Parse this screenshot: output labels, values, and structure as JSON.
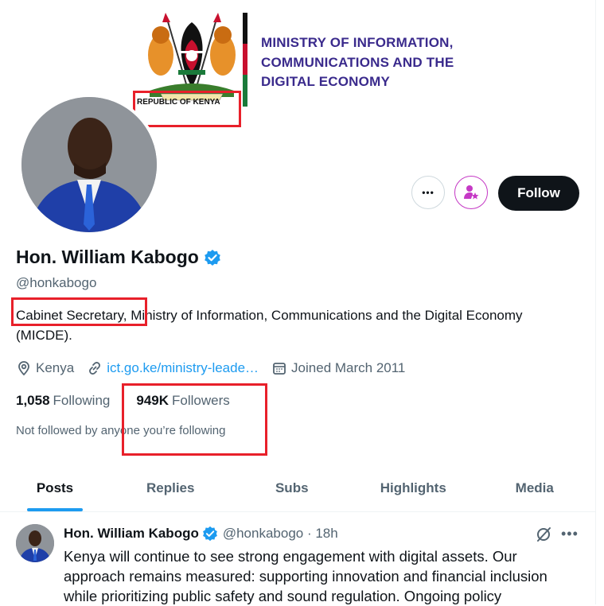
{
  "banner": {
    "ministry_lines": [
      "MINISTRY OF INFORMATION,",
      "COMMUNICATIONS AND THE",
      "DIGITAL ECONOMY"
    ],
    "motto": "REPUBLIC OF KENYA"
  },
  "actions": {
    "more_label": "•••",
    "follow_label": "Follow"
  },
  "profile": {
    "name": "Hon. William Kabogo",
    "handle": "@honkabogo",
    "bio": "Cabinet Secretary, Ministry of  Information, Communications and the Digital Economy (MICDE).",
    "location": "Kenya",
    "website": "ict.go.ke/ministry-leade…",
    "joined": "Joined March 2011",
    "following_count": "1,058",
    "following_label": "Following",
    "followers_count": "949K",
    "followers_label": "Followers",
    "not_followed": "Not followed by anyone you’re following"
  },
  "tabs": [
    "Posts",
    "Replies",
    "Subs",
    "Highlights",
    "Media"
  ],
  "tweet": {
    "name": "Hon. William Kabogo",
    "handle": "@honkabogo · 18h",
    "text": "Kenya will continue to see strong engagement with digital assets. Our approach remains measured: supporting innovation and financial inclusion while prioritizing public safety and sound regulation. Ongoing policy",
    "more_label": "•••"
  },
  "colors": {
    "accent": "#1d9bf0",
    "annotation": "#e8202a",
    "ministry_text": "#3a2a8c"
  }
}
